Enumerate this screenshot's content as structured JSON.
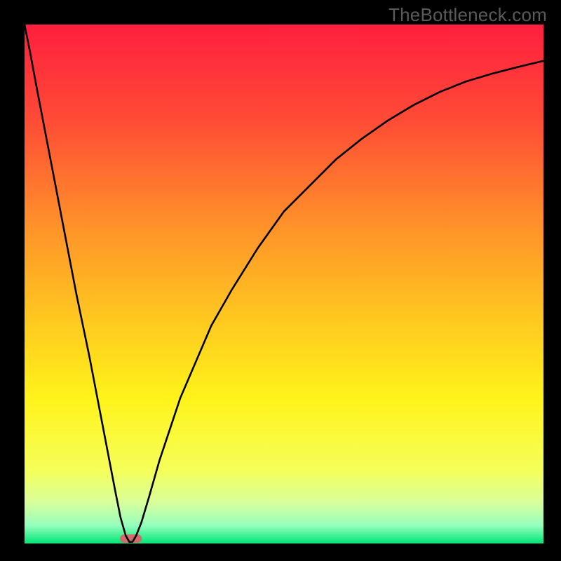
{
  "watermark": "TheBottleneck.com",
  "chart_data": {
    "type": "line",
    "title": "",
    "xlabel": "",
    "ylabel": "",
    "xlim": [
      0,
      100
    ],
    "ylim": [
      0,
      100
    ],
    "grid": false,
    "legend": false,
    "gradient_stops": [
      {
        "offset": 0.0,
        "color": "#ff1f3f"
      },
      {
        "offset": 0.18,
        "color": "#ff4a36"
      },
      {
        "offset": 0.38,
        "color": "#ff8f2a"
      },
      {
        "offset": 0.55,
        "color": "#ffc321"
      },
      {
        "offset": 0.72,
        "color": "#fff31a"
      },
      {
        "offset": 0.86,
        "color": "#f5ff5a"
      },
      {
        "offset": 0.92,
        "color": "#d9ff9a"
      },
      {
        "offset": 0.965,
        "color": "#96ffbe"
      },
      {
        "offset": 1.0,
        "color": "#00e676"
      }
    ],
    "series": [
      {
        "name": "curve",
        "color": "#000000",
        "x": [
          0,
          1,
          2.5,
          5,
          7.5,
          10,
          12.5,
          15,
          17.5,
          18.5,
          19.5,
          20.2,
          20.8,
          21.5,
          22.5,
          24,
          26,
          28,
          30,
          33,
          36,
          40,
          45,
          50,
          55,
          60,
          65,
          70,
          75,
          80,
          85,
          90,
          95,
          100
        ],
        "y": [
          100,
          95,
          87,
          74,
          61,
          48,
          36,
          23,
          10,
          5,
          1.5,
          0.3,
          0.3,
          1.5,
          4,
          9,
          16,
          22,
          28,
          35,
          42,
          49,
          57,
          64,
          69,
          74,
          78,
          81.5,
          84.5,
          87,
          89,
          90.5,
          91.8,
          93
        ]
      }
    ],
    "marker": {
      "name": "min-marker",
      "shape": "pill",
      "color": "#d46a6a",
      "x_center": 20.5,
      "width": 4.2,
      "height": 1.6
    }
  }
}
